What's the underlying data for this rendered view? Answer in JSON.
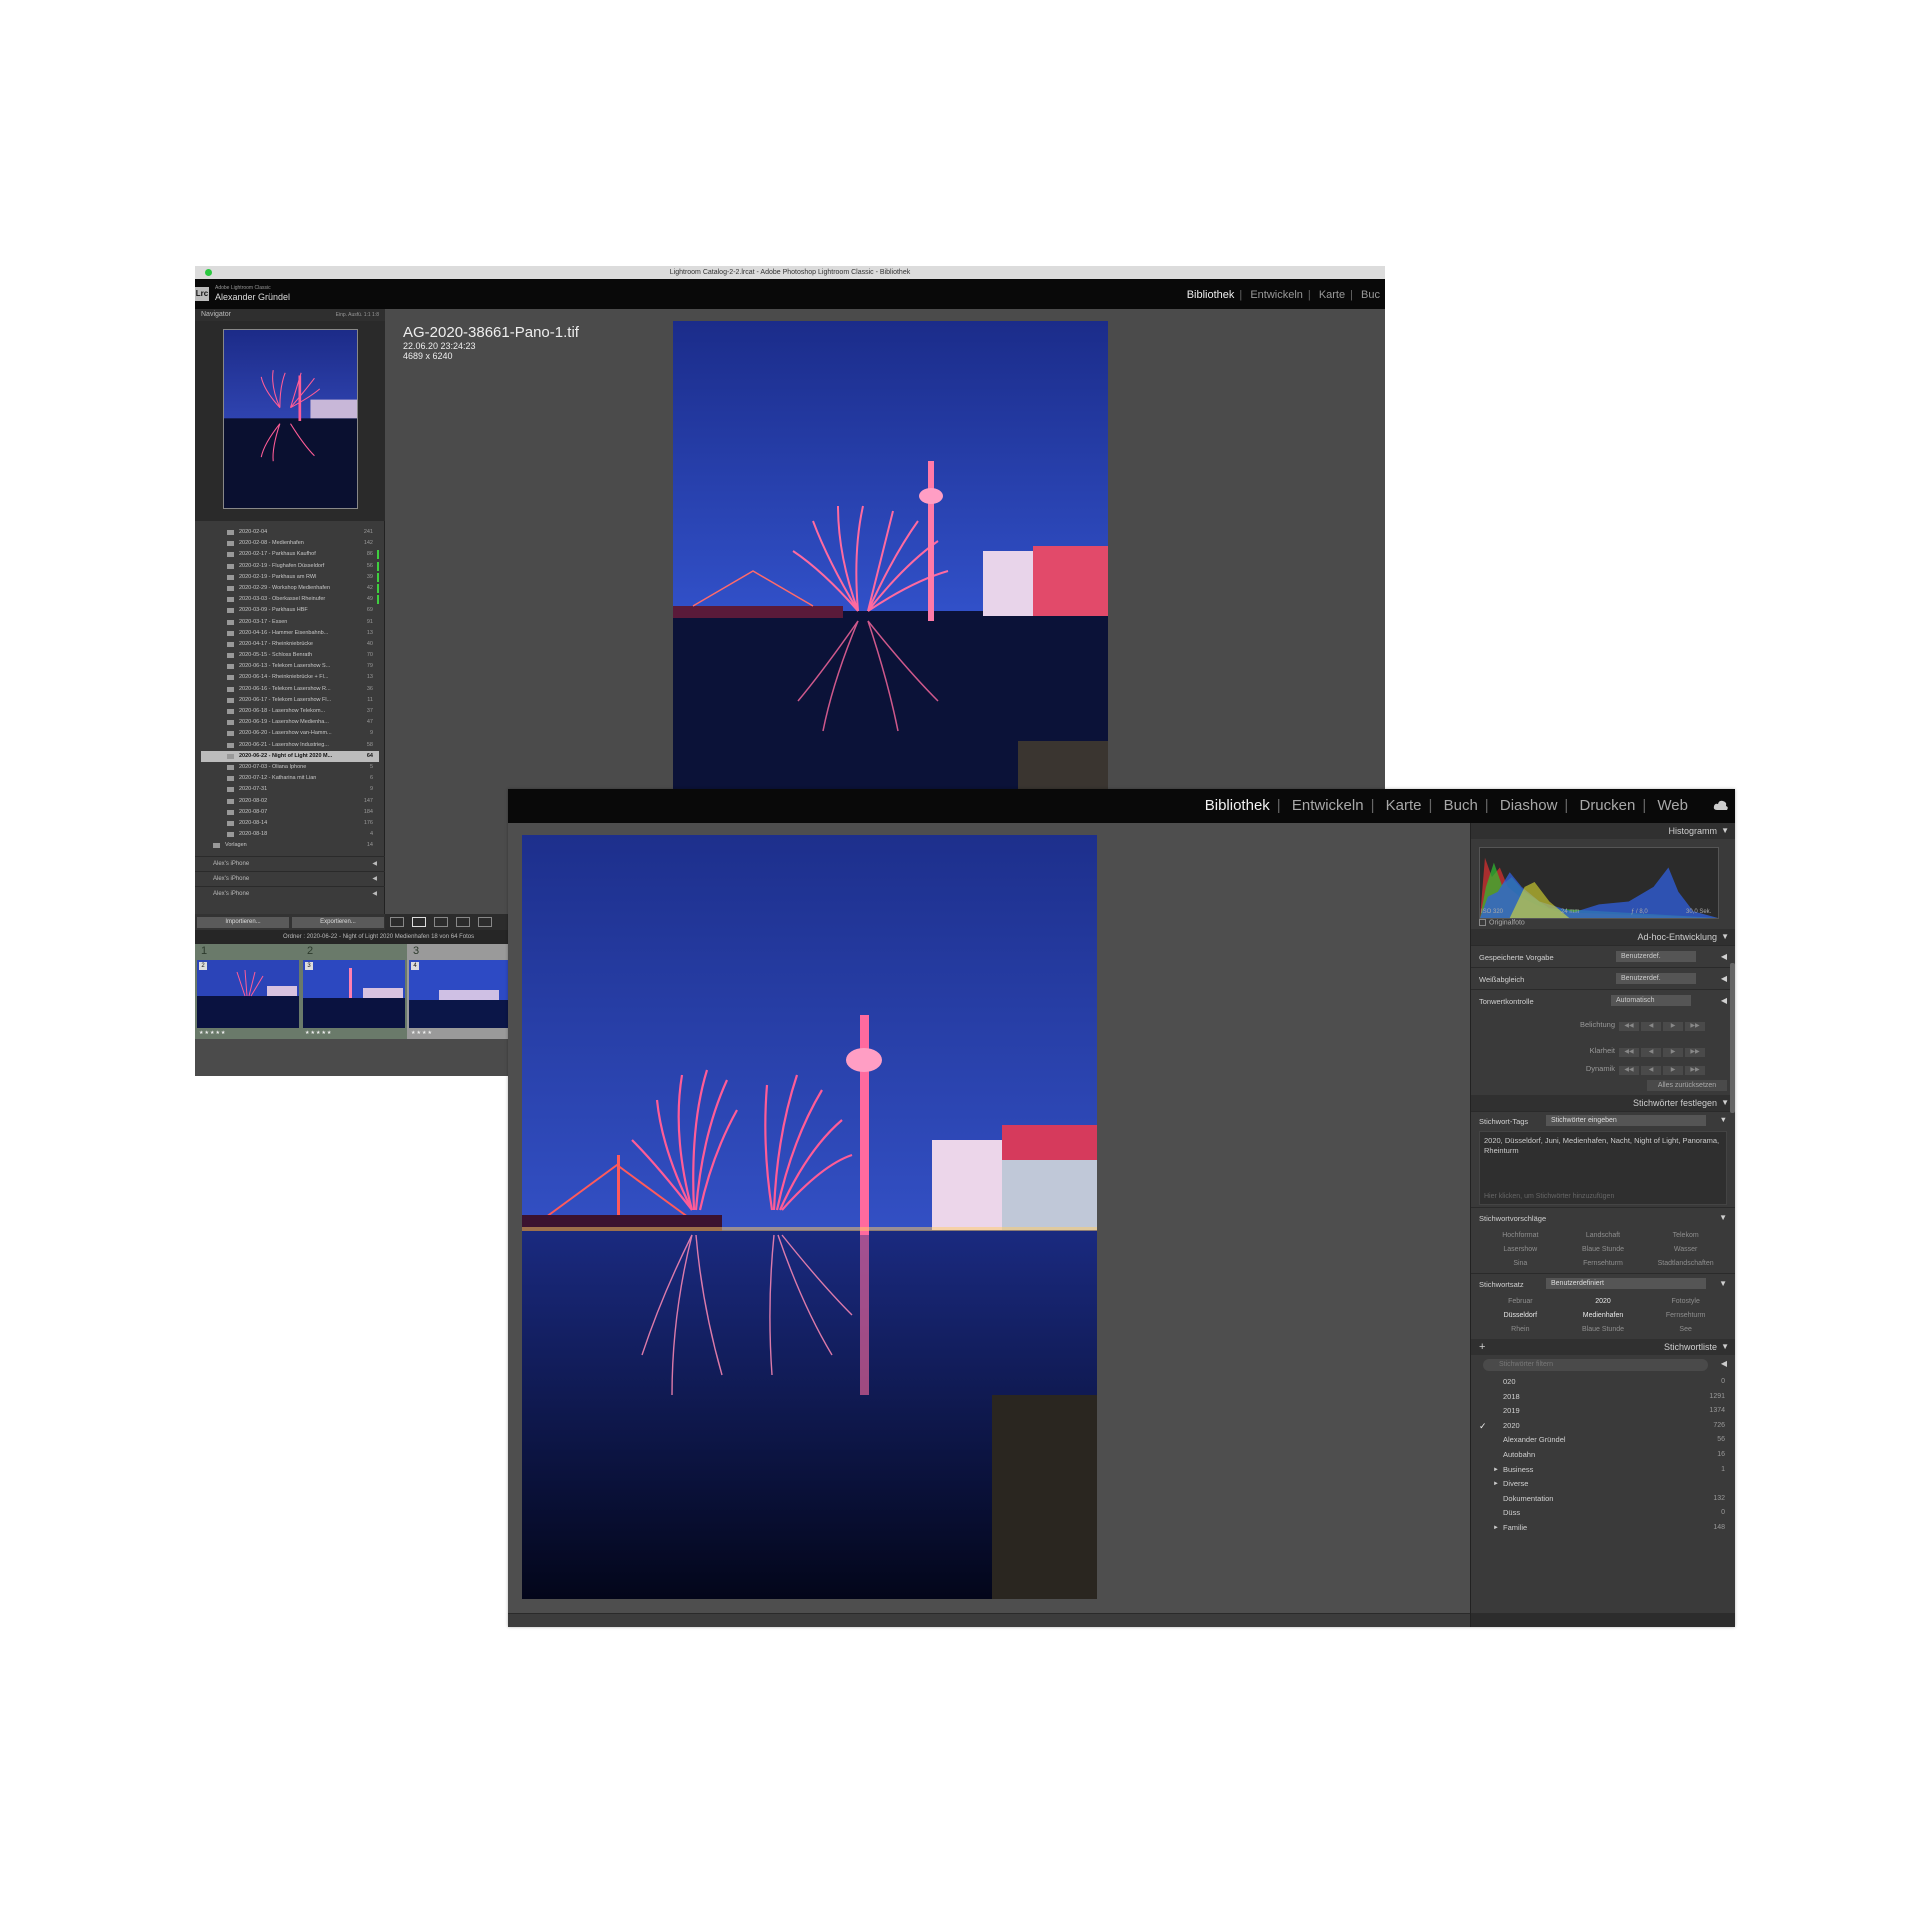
{
  "back_window": {
    "titlebar": "Lightroom Catalog-2-2.lrcat - Adobe Photoshop Lightroom Classic - Bibliothek",
    "logo": "Lrc",
    "app_name": "Adobe Lightroom Classic",
    "user_name": "Alexander Gründel",
    "modules": [
      "Bibliothek",
      "Entwickeln",
      "Karte",
      "Buc"
    ],
    "navigator_label": "Navigator",
    "zoom_options": "Einp.  Ausfü.  1:1  1:8",
    "folders": [
      {
        "name": "2020-02-04",
        "count": "241"
      },
      {
        "name": "2020-02-08 - Medienhafen",
        "count": "142"
      },
      {
        "name": "2020-02-17 - Parkhaus Kaufhof",
        "count": "86"
      },
      {
        "name": "2020-02-19 - Flughafen Düsseldorf",
        "count": "56"
      },
      {
        "name": "2020-02-19 - Parkhaus am RWI",
        "count": "39"
      },
      {
        "name": "2020-02-29 - Workshop Medienhafen",
        "count": "42"
      },
      {
        "name": "2020-03-03 - Oberkassel Rheinufer",
        "count": "49"
      },
      {
        "name": "2020-03-09 - Parkhaus HBF",
        "count": "69"
      },
      {
        "name": "2020-03-17 - Essen",
        "count": "91"
      },
      {
        "name": "2020-04-16 - Hammer Eisenbahnb...",
        "count": "13"
      },
      {
        "name": "2020-04-17 - Rheinkniebrücke",
        "count": "40"
      },
      {
        "name": "2020-05-15 - Schloss Benrath",
        "count": "70"
      },
      {
        "name": "2020-06-13 - Telekom Lasershow S...",
        "count": "79"
      },
      {
        "name": "2020-06-14 - Rheinkniebrücke + Fl...",
        "count": "13"
      },
      {
        "name": "2020-06-16 - Telekom Lasershow R...",
        "count": "36"
      },
      {
        "name": "2020-06-17 - Telekom Lasershow Fl...",
        "count": "11"
      },
      {
        "name": "2020-06-18 - Lasershow Telekom...",
        "count": "37"
      },
      {
        "name": "2020-06-19 - Lasershow Medienha...",
        "count": "47"
      },
      {
        "name": "2020-06-20 - Lasershow van-Hamm...",
        "count": "9"
      },
      {
        "name": "2020-06-21 - Lasershow Industrieg...",
        "count": "58"
      },
      {
        "name": "2020-06-22 - Night of Light 2020 M...",
        "count": "64"
      },
      {
        "name": "2020-07-03 - Oliana Iphone",
        "count": "5"
      },
      {
        "name": "2020-07-12 - Katharina mit Lian",
        "count": "6"
      },
      {
        "name": "2020-07-31",
        "count": "9"
      },
      {
        "name": "2020-08-02",
        "count": "147"
      },
      {
        "name": "2020-08-07",
        "count": "184"
      },
      {
        "name": "2020-08-14",
        "count": "176"
      },
      {
        "name": "2020-08-18",
        "count": "4"
      },
      {
        "name": "Vorlagen",
        "count": "14"
      }
    ],
    "phones": [
      "Alex's iPhone",
      "Alex's iPhone",
      "Alex's iPhone"
    ],
    "import_label": "Importieren...",
    "export_label": "Exportieren...",
    "filmstrip_text": "Ordner : 2020-06-22 - Night of Light 2020 Medienhafen   18 von 64 Fotos",
    "film_cells": [
      {
        "num": "1",
        "badge": "2",
        "stars": "★★★★★"
      },
      {
        "num": "2",
        "badge": "3",
        "stars": "★★★★★"
      },
      {
        "num": "3",
        "badge": "4",
        "stars": "★★★★"
      }
    ],
    "filename": "AG-2020-38661-Pano-1.tif",
    "date": "22.06.20 23:24:23",
    "dimensions": "4689 x 6240"
  },
  "front_window": {
    "modules": [
      "Bibliothek",
      "Entwickeln",
      "Karte",
      "Buch",
      "Diashow",
      "Drucken",
      "Web"
    ],
    "panels": {
      "histogram": "Histogramm",
      "iso": "ISO 320",
      "focal": "24 mm",
      "aperture": "ƒ / 8,0",
      "shutter": "30,0 Sek.",
      "original_photo": "Originalfoto",
      "quick_develop": "Ad-hoc-Entwicklung",
      "saved_preset_label": "Gespeicherte Vorgabe",
      "saved_preset_value": "Benutzerdef.",
      "white_balance_label": "Weißabgleich",
      "white_balance_value": "Benutzerdef.",
      "tone_label": "Tonwertkontrolle",
      "tone_value": "Automatisch",
      "exposure": "Belichtung",
      "clarity": "Klarheit",
      "vibrance": "Dynamik",
      "reset_all": "Alles zurücksetzen",
      "keywording": "Stichwörter festlegen",
      "kw_tags_label": "Stichwort-Tags",
      "kw_tags_value": "Stichwörter eingeben",
      "kw_text": "2020, Düsseldorf, Juni, Medienhafen, Nacht, Night of Light, Panorama, Rheinturm",
      "kw_placeholder": "Hier klicken, um Stichwörter hinzuzufügen",
      "suggestions_label": "Stichwortvorschläge",
      "suggestions": [
        "Hochformat",
        "Landschaft",
        "Telekom",
        "Lasershow",
        "Blaue Stunde",
        "Wasser",
        "Sina",
        "Fernsehturm",
        "Stadtlandschaften"
      ],
      "kw_set_label": "Stichwortsatz",
      "kw_set_value": "Benutzerdefiniert",
      "kw_set": [
        {
          "name": "Februar",
          "on": false
        },
        {
          "name": "2020",
          "on": true
        },
        {
          "name": "Fotostyle",
          "on": false
        },
        {
          "name": "Düsseldorf",
          "on": true
        },
        {
          "name": "Medienhafen",
          "on": true
        },
        {
          "name": "Fernsehturm",
          "on": false
        },
        {
          "name": "Rhein",
          "on": false
        },
        {
          "name": "Blaue Stunde",
          "on": false
        },
        {
          "name": "See",
          "on": false
        }
      ],
      "kw_list_label": "Stichwortliste",
      "kw_filter_placeholder": "Stichwörter filtern",
      "kw_list": [
        {
          "name": "020",
          "count": "0",
          "check": "",
          "exp": ""
        },
        {
          "name": "2018",
          "count": "1291",
          "check": "",
          "exp": ""
        },
        {
          "name": "2019",
          "count": "1374",
          "check": "",
          "exp": ""
        },
        {
          "name": "2020",
          "count": "726",
          "check": "✓",
          "exp": ""
        },
        {
          "name": "Alexander Gründel",
          "count": "56",
          "check": "",
          "exp": ""
        },
        {
          "name": "Autobahn",
          "count": "16",
          "check": "",
          "exp": ""
        },
        {
          "name": "Business",
          "count": "1",
          "check": "",
          "exp": "►"
        },
        {
          "name": "Diverse",
          "count": "",
          "check": "",
          "exp": "►"
        },
        {
          "name": "Dokumentation",
          "count": "132",
          "check": "",
          "exp": ""
        },
        {
          "name": "Düss",
          "count": "0",
          "check": "",
          "exp": ""
        },
        {
          "name": "Familie",
          "count": "148",
          "check": "",
          "exp": "►"
        }
      ]
    }
  },
  "colors": {
    "lr_dark": "#090909",
    "panel": "#3a3a3a",
    "center": "#4e4e4e",
    "sky_top": "#1d2f8c",
    "firework": "#ff4f8a"
  }
}
